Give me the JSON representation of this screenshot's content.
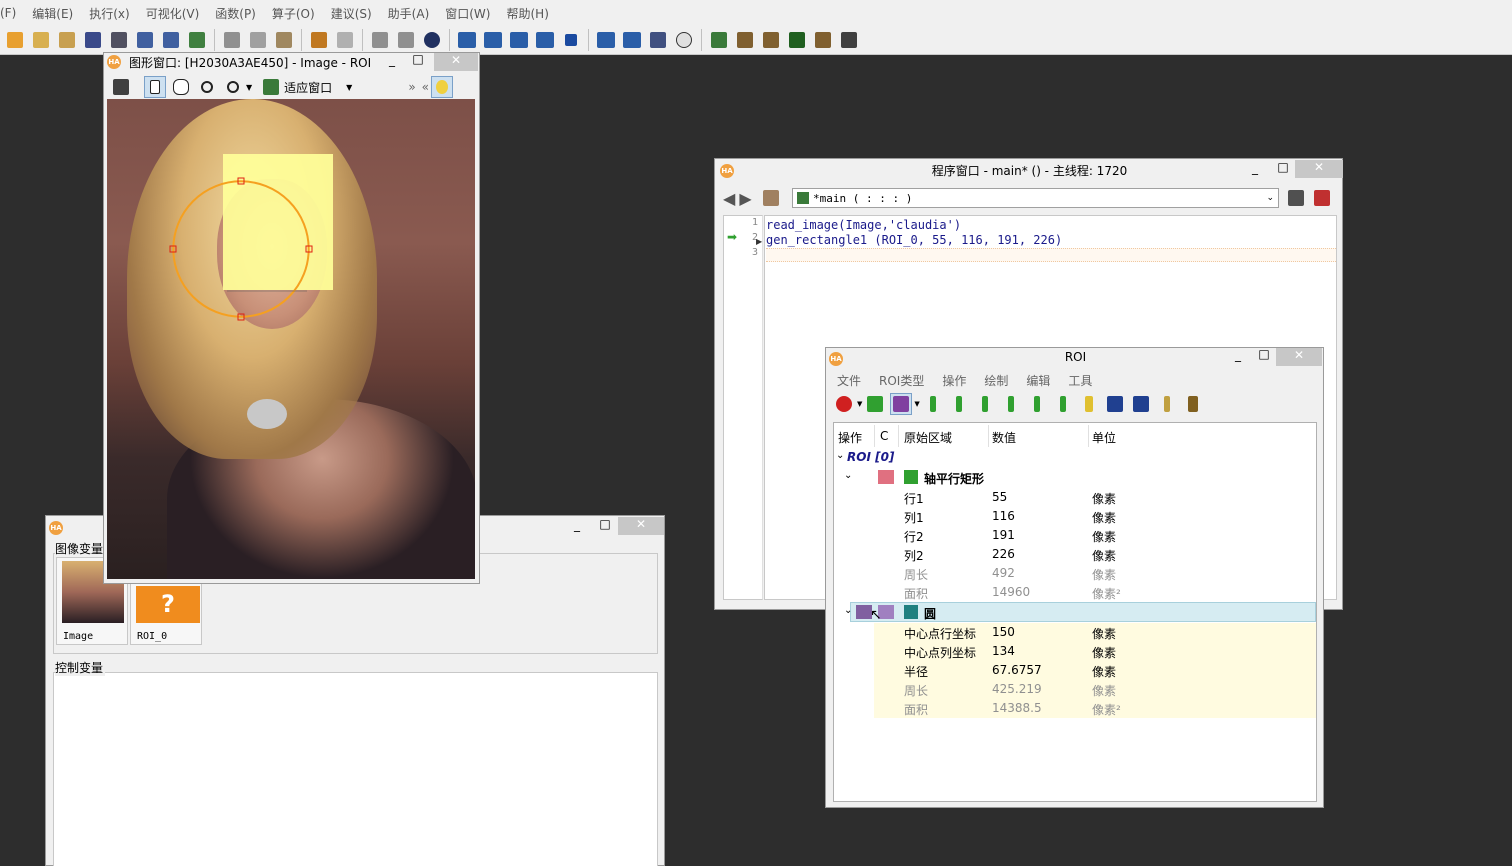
{
  "menubar": [
    "(F)",
    "编辑(E)",
    "执行(x)",
    "可视化(V)",
    "函数(P)",
    "算子(O)",
    "建议(S)",
    "助手(A)",
    "窗口(W)",
    "帮助(H)"
  ],
  "graphics_window": {
    "title": "图形窗口: [H2030A3AE450] - Image - ROI",
    "fit_label": "适应窗口"
  },
  "variable_window": {
    "image_vars_label": "图像变量",
    "control_vars_label": "控制变量",
    "thumb1": "Image",
    "thumb2": "ROI_0"
  },
  "program_window": {
    "title": "程序窗口 - main* () - 主线程: 1720",
    "procedure": "*main ( : : : )",
    "lines": [
      "read_image(Image,'claudia')",
      "gen_rectangle1 (ROI_0, 55, 116, 191, 226)",
      ""
    ]
  },
  "roi_window": {
    "title": "ROI",
    "menu": [
      "文件",
      "ROI类型",
      "操作",
      "绘制",
      "编辑",
      "工具"
    ],
    "headers": [
      "操作",
      "C",
      "原始区域",
      "数值",
      "单位"
    ],
    "root": "ROI [0]",
    "rect_name": "轴平行矩形",
    "rect_rows": [
      {
        "k": "行1",
        "v": "55",
        "u": "像素"
      },
      {
        "k": "列1",
        "v": "116",
        "u": "像素"
      },
      {
        "k": "行2",
        "v": "191",
        "u": "像素"
      },
      {
        "k": "列2",
        "v": "226",
        "u": "像素"
      },
      {
        "k": "周长",
        "v": "492",
        "u": "像素"
      },
      {
        "k": "面积",
        "v": "14960",
        "u": "像素²"
      }
    ],
    "circle_name": "圆",
    "circle_rows": [
      {
        "k": "中心点行坐标",
        "v": "150",
        "u": "像素"
      },
      {
        "k": "中心点列坐标",
        "v": "134",
        "u": "像素"
      },
      {
        "k": "半径",
        "v": "67.6757",
        "u": "像素"
      },
      {
        "k": "周长",
        "v": "425.219",
        "u": "像素"
      },
      {
        "k": "面积",
        "v": "14388.5",
        "u": "像素²"
      }
    ]
  },
  "colors": {
    "accent_orange": "#f5a020",
    "roi_rect": "#ffff99",
    "selection": "#d6ecf2",
    "highlight": "#fffbe0"
  }
}
